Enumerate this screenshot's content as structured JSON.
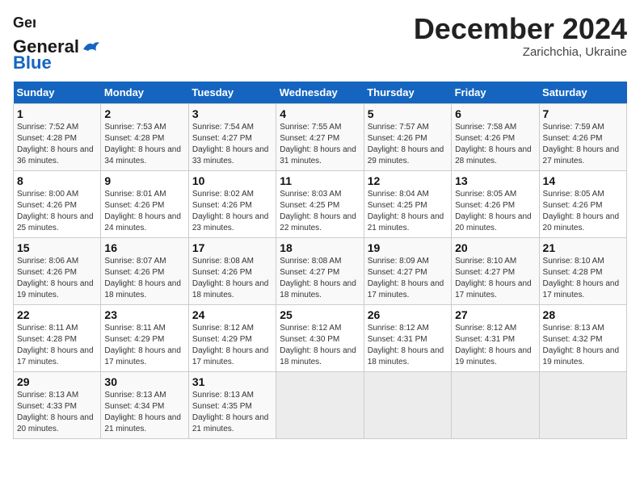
{
  "logo": {
    "line1": "General",
    "line2": "Blue"
  },
  "title": "December 2024",
  "subtitle": "Zarichchia, Ukraine",
  "days_header": [
    "Sunday",
    "Monday",
    "Tuesday",
    "Wednesday",
    "Thursday",
    "Friday",
    "Saturday"
  ],
  "weeks": [
    [
      {
        "day": "1",
        "sunrise": "7:52 AM",
        "sunset": "4:28 PM",
        "daylight": "8 hours and 36 minutes."
      },
      {
        "day": "2",
        "sunrise": "7:53 AM",
        "sunset": "4:28 PM",
        "daylight": "8 hours and 34 minutes."
      },
      {
        "day": "3",
        "sunrise": "7:54 AM",
        "sunset": "4:27 PM",
        "daylight": "8 hours and 33 minutes."
      },
      {
        "day": "4",
        "sunrise": "7:55 AM",
        "sunset": "4:27 PM",
        "daylight": "8 hours and 31 minutes."
      },
      {
        "day": "5",
        "sunrise": "7:57 AM",
        "sunset": "4:26 PM",
        "daylight": "8 hours and 29 minutes."
      },
      {
        "day": "6",
        "sunrise": "7:58 AM",
        "sunset": "4:26 PM",
        "daylight": "8 hours and 28 minutes."
      },
      {
        "day": "7",
        "sunrise": "7:59 AM",
        "sunset": "4:26 PM",
        "daylight": "8 hours and 27 minutes."
      }
    ],
    [
      {
        "day": "8",
        "sunrise": "8:00 AM",
        "sunset": "4:26 PM",
        "daylight": "8 hours and 25 minutes."
      },
      {
        "day": "9",
        "sunrise": "8:01 AM",
        "sunset": "4:26 PM",
        "daylight": "8 hours and 24 minutes."
      },
      {
        "day": "10",
        "sunrise": "8:02 AM",
        "sunset": "4:26 PM",
        "daylight": "8 hours and 23 minutes."
      },
      {
        "day": "11",
        "sunrise": "8:03 AM",
        "sunset": "4:25 PM",
        "daylight": "8 hours and 22 minutes."
      },
      {
        "day": "12",
        "sunrise": "8:04 AM",
        "sunset": "4:25 PM",
        "daylight": "8 hours and 21 minutes."
      },
      {
        "day": "13",
        "sunrise": "8:05 AM",
        "sunset": "4:26 PM",
        "daylight": "8 hours and 20 minutes."
      },
      {
        "day": "14",
        "sunrise": "8:05 AM",
        "sunset": "4:26 PM",
        "daylight": "8 hours and 20 minutes."
      }
    ],
    [
      {
        "day": "15",
        "sunrise": "8:06 AM",
        "sunset": "4:26 PM",
        "daylight": "8 hours and 19 minutes."
      },
      {
        "day": "16",
        "sunrise": "8:07 AM",
        "sunset": "4:26 PM",
        "daylight": "8 hours and 18 minutes."
      },
      {
        "day": "17",
        "sunrise": "8:08 AM",
        "sunset": "4:26 PM",
        "daylight": "8 hours and 18 minutes."
      },
      {
        "day": "18",
        "sunrise": "8:08 AM",
        "sunset": "4:27 PM",
        "daylight": "8 hours and 18 minutes."
      },
      {
        "day": "19",
        "sunrise": "8:09 AM",
        "sunset": "4:27 PM",
        "daylight": "8 hours and 17 minutes."
      },
      {
        "day": "20",
        "sunrise": "8:10 AM",
        "sunset": "4:27 PM",
        "daylight": "8 hours and 17 minutes."
      },
      {
        "day": "21",
        "sunrise": "8:10 AM",
        "sunset": "4:28 PM",
        "daylight": "8 hours and 17 minutes."
      }
    ],
    [
      {
        "day": "22",
        "sunrise": "8:11 AM",
        "sunset": "4:28 PM",
        "daylight": "8 hours and 17 minutes."
      },
      {
        "day": "23",
        "sunrise": "8:11 AM",
        "sunset": "4:29 PM",
        "daylight": "8 hours and 17 minutes."
      },
      {
        "day": "24",
        "sunrise": "8:12 AM",
        "sunset": "4:29 PM",
        "daylight": "8 hours and 17 minutes."
      },
      {
        "day": "25",
        "sunrise": "8:12 AM",
        "sunset": "4:30 PM",
        "daylight": "8 hours and 18 minutes."
      },
      {
        "day": "26",
        "sunrise": "8:12 AM",
        "sunset": "4:31 PM",
        "daylight": "8 hours and 18 minutes."
      },
      {
        "day": "27",
        "sunrise": "8:12 AM",
        "sunset": "4:31 PM",
        "daylight": "8 hours and 19 minutes."
      },
      {
        "day": "28",
        "sunrise": "8:13 AM",
        "sunset": "4:32 PM",
        "daylight": "8 hours and 19 minutes."
      }
    ],
    [
      {
        "day": "29",
        "sunrise": "8:13 AM",
        "sunset": "4:33 PM",
        "daylight": "8 hours and 20 minutes."
      },
      {
        "day": "30",
        "sunrise": "8:13 AM",
        "sunset": "4:34 PM",
        "daylight": "8 hours and 21 minutes."
      },
      {
        "day": "31",
        "sunrise": "8:13 AM",
        "sunset": "4:35 PM",
        "daylight": "8 hours and 21 minutes."
      },
      null,
      null,
      null,
      null
    ]
  ]
}
